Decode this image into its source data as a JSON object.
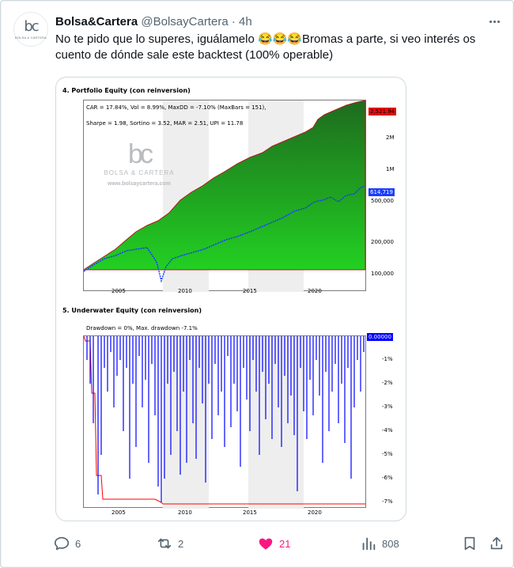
{
  "tweet": {
    "author_name": "Bolsa&Cartera",
    "author_handle": "@BolsayCartera",
    "separator": "·",
    "time": "4h",
    "text": "No te pido que lo superes, iguálamelo 😂😂😂Bromas a parte, si veo interés os cuento de dónde sale este backtest (100% operable)"
  },
  "avatar": {
    "mark": "bc",
    "sub": "BOLSA & CARTERA"
  },
  "media": {
    "chart1": {
      "title": "4. Portfolio Equity (con reinversion)",
      "stats_line1": "CAR = 17.84%, Vol = 8.99%, MaxDD = -7.10% (MaxBars = 151),",
      "stats_line2": "Sharpe = 1.98, Sortino = 3.52, MAR = 2.51, UPI = 11.78",
      "watermark_name": "BOLSA & CARTERA",
      "watermark_url": "www.bolsaycartera.com",
      "watermark_mark": "bc",
      "badge_top": "2,521.94",
      "badge_blue": "614,719",
      "y_ticks": [
        "2M",
        "1M",
        "500,000",
        "200,000",
        "100,000"
      ],
      "x_ticks": [
        "2005",
        "2010",
        "2015",
        "2020"
      ]
    },
    "chart2": {
      "title": "5. Underwater Equity (con reinversion)",
      "stats": "Drawdown = 0%, Max. drawdown -7.1%",
      "badge": "0.00000",
      "y_ticks": [
        "-1%",
        "-2%",
        "-3%",
        "-4%",
        "-5%",
        "-6%",
        "-7%"
      ],
      "x_ticks": [
        "2005",
        "2010",
        "2015",
        "2020"
      ]
    }
  },
  "chart_data": [
    {
      "type": "area",
      "title": "4. Portfolio Equity (con reinversion)",
      "x": [
        2002,
        2004,
        2006,
        2008,
        2009,
        2010,
        2012,
        2014,
        2016,
        2018,
        2019,
        2020,
        2021,
        2022,
        2023.5
      ],
      "series": [
        {
          "values": [
            100000,
            130000,
            190000,
            300000,
            330000,
            400000,
            500000,
            650000,
            800000,
            1000000,
            1100000,
            1800000,
            2100000,
            2300000,
            2520000
          ]
        },
        {
          "values": [
            100000,
            120000,
            140000,
            170000,
            110000,
            160000,
            190000,
            230000,
            280000,
            330000,
            380000,
            400000,
            450000,
            520000,
            614719
          ]
        }
      ],
      "y_scale": "log",
      "ylim": [
        85000,
        2800000
      ],
      "colors": {
        "area_top": "#1e6b1e",
        "area_bottom": "#22c922",
        "benchmark": "#1a3cff"
      }
    },
    {
      "type": "line",
      "title": "5. Underwater Equity (con reinversion)",
      "ylim": [
        -7.3,
        0
      ],
      "max_drawdown": -7.1,
      "colors": {
        "drawdown": "#0000ff",
        "max_line": "#ff0000"
      }
    }
  ],
  "actions": {
    "replies": "6",
    "reposts": "2",
    "likes": "21",
    "views": "808"
  },
  "colors": {
    "like": "#f91880",
    "text_secondary": "#536471"
  }
}
